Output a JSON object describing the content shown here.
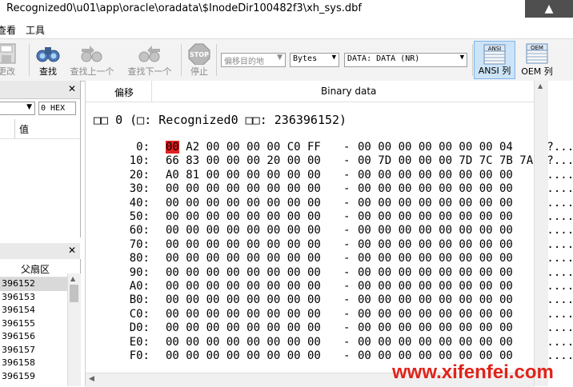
{
  "window": {
    "title": "Recognized0\\u01\\app\\oracle\\oradata\\$InodeDir100482f3\\xh_sys.dbf",
    "control_icon": "pin-icon"
  },
  "menu": {
    "items": [
      "查看",
      "工具"
    ]
  },
  "toolbar": {
    "buttons": [
      {
        "label": "更改",
        "icon": "save-icon",
        "enabled": false
      },
      {
        "label": "查找",
        "icon": "binoculars-icon",
        "enabled": true
      },
      {
        "label": "查找上一个",
        "icon": "find-prev-icon",
        "enabled": false
      },
      {
        "label": "查找下一个",
        "icon": "find-next-icon",
        "enabled": false
      },
      {
        "label": "停止",
        "icon": "stop-icon",
        "enabled": false
      }
    ],
    "goto_placeholder": "偏移目的地",
    "unit_select": "Bytes",
    "data_select": "DATA: DATA (NR)",
    "ansi_button": {
      "icon_text": "ANSI",
      "label": "ANSI 列",
      "active": true
    },
    "oem_button": {
      "icon_text": "OEM",
      "label": "OEM 列",
      "active": false
    }
  },
  "left_panel": {
    "hex_field": "0 HEX",
    "value_header": "值",
    "sectors_header": "父扇区",
    "sectors": [
      "396152",
      "396153",
      "396154",
      "396155",
      "396156",
      "396157",
      "396158",
      "396159"
    ],
    "selected_index": 0
  },
  "hex_view": {
    "col_offset_label": "偏移",
    "col_binary_label": "Binary data",
    "block_line": "□□ 0 (□: Recognized0 □□: 236396152)",
    "rows": [
      {
        "offset": "0:",
        "bytes1": "00 A2 00 00 00 00 C0 FF",
        "bytes2": "00 00 00 00 00 00 00 04",
        "ascii": ".?......"
      },
      {
        "offset": "10:",
        "bytes1": "66 83 00 00 00 20 00 00",
        "bytes2": "00 7D 00 00 00 7D 7C 7B 7A",
        "ascii": "f?......"
      },
      {
        "offset": "20:",
        "bytes1": "A0 81 00 00 00 00 00 00",
        "bytes2": "00 00 00 00 00 00 00 00",
        "ascii": "□......."
      },
      {
        "offset": "30:",
        "bytes1": "00 00 00 00 00 00 00 00",
        "bytes2": "00 00 00 00 00 00 00 00",
        "ascii": "........"
      },
      {
        "offset": "40:",
        "bytes1": "00 00 00 00 00 00 00 00",
        "bytes2": "00 00 00 00 00 00 00 00",
        "ascii": "........"
      },
      {
        "offset": "50:",
        "bytes1": "00 00 00 00 00 00 00 00",
        "bytes2": "00 00 00 00 00 00 00 00",
        "ascii": "........"
      },
      {
        "offset": "60:",
        "bytes1": "00 00 00 00 00 00 00 00",
        "bytes2": "00 00 00 00 00 00 00 00",
        "ascii": "........"
      },
      {
        "offset": "70:",
        "bytes1": "00 00 00 00 00 00 00 00",
        "bytes2": "00 00 00 00 00 00 00 00",
        "ascii": "........"
      },
      {
        "offset": "80:",
        "bytes1": "00 00 00 00 00 00 00 00",
        "bytes2": "00 00 00 00 00 00 00 00",
        "ascii": "........"
      },
      {
        "offset": "90:",
        "bytes1": "00 00 00 00 00 00 00 00",
        "bytes2": "00 00 00 00 00 00 00 00",
        "ascii": "........"
      },
      {
        "offset": "A0:",
        "bytes1": "00 00 00 00 00 00 00 00",
        "bytes2": "00 00 00 00 00 00 00 00",
        "ascii": "........"
      },
      {
        "offset": "B0:",
        "bytes1": "00 00 00 00 00 00 00 00",
        "bytes2": "00 00 00 00 00 00 00 00",
        "ascii": "........"
      },
      {
        "offset": "C0:",
        "bytes1": "00 00 00 00 00 00 00 00",
        "bytes2": "00 00 00 00 00 00 00 00",
        "ascii": "........"
      },
      {
        "offset": "D0:",
        "bytes1": "00 00 00 00 00 00 00 00",
        "bytes2": "00 00 00 00 00 00 00 00",
        "ascii": "........"
      },
      {
        "offset": "E0:",
        "bytes1": "00 00 00 00 00 00 00 00",
        "bytes2": "00 00 00 00 00 00 00 00",
        "ascii": "........"
      },
      {
        "offset": "F0:",
        "bytes1": "00 00 00 00 00 00 00 00",
        "bytes2": "00 00 00 00 00 00 00 00",
        "ascii": "........"
      }
    ],
    "separator": "-",
    "highlight_color": "#e02020"
  },
  "watermark": "www.xifenfei.com",
  "colors": {
    "accent": "#cce4f7",
    "watermark": "#e0231a"
  }
}
